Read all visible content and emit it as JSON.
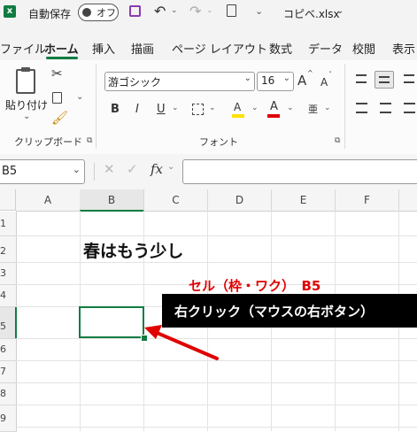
{
  "titlebar": {
    "autosave_label": "自動保存",
    "autosave_state": "オフ",
    "filename": "コピベ.xlsx"
  },
  "tabs": [
    "ファイル",
    "ホーム",
    "挿入",
    "描画",
    "ページ レイアウト",
    "数式",
    "データ",
    "校閲",
    "表示"
  ],
  "ribbon": {
    "paste_label": "貼り付け",
    "clipboard_group": "クリップボード",
    "font_group": "フォント",
    "font_name": "游ゴシック",
    "font_size": "16",
    "bold": "B",
    "italic": "I",
    "underline": "U",
    "grow_font": "A",
    "shrink_font": "A",
    "fill_letter": "A",
    "font_color_letter": "A",
    "phonetic_letter": "亜",
    "fill_color": "#ffe100",
    "font_color": "#e00000"
  },
  "formula_bar": {
    "name_box": "B5",
    "fx": "fx",
    "formula": ""
  },
  "columns": [
    "A",
    "B",
    "C",
    "D",
    "E",
    "F"
  ],
  "rows": [
    "1",
    "2",
    "3",
    "4",
    "5",
    "6",
    "7",
    "8",
    "9"
  ],
  "cells": {
    "B2": "春はもう少し"
  },
  "annotations": {
    "cell_label": "セル（枠・ワク）　B5",
    "right_click_label": "右クリック（マウスの右ボタン）",
    "annotation_color": "#e00000"
  }
}
